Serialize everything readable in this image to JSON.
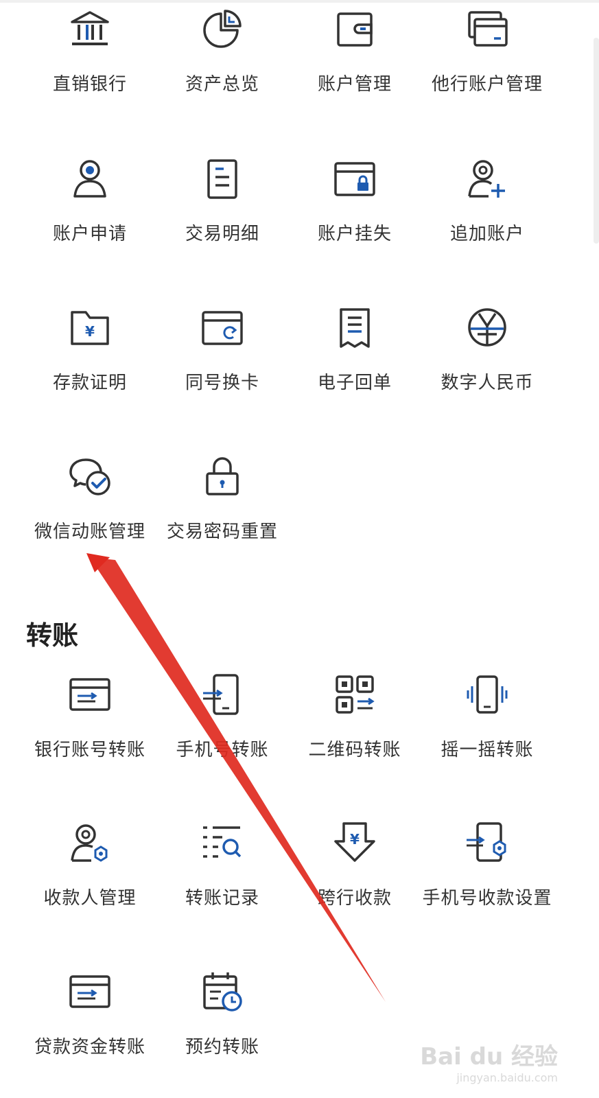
{
  "account_section": {
    "items": [
      {
        "label": "直销银行",
        "icon": "bank-icon"
      },
      {
        "label": "资产总览",
        "icon": "pie-chart-icon"
      },
      {
        "label": "账户管理",
        "icon": "wallet-icon"
      },
      {
        "label": "他行账户管理",
        "icon": "cards-icon"
      },
      {
        "label": "账户申请",
        "icon": "user-icon"
      },
      {
        "label": "交易明细",
        "icon": "document-icon"
      },
      {
        "label": "账户挂失",
        "icon": "card-lock-icon"
      },
      {
        "label": "追加账户",
        "icon": "user-add-icon"
      },
      {
        "label": "存款证明",
        "icon": "folder-yen-icon"
      },
      {
        "label": "同号换卡",
        "icon": "card-refresh-icon"
      },
      {
        "label": "电子回单",
        "icon": "receipt-icon"
      },
      {
        "label": "数字人民币",
        "icon": "digital-yuan-icon"
      },
      {
        "label": "微信动账管理",
        "icon": "wechat-check-icon"
      },
      {
        "label": "交易密码重置",
        "icon": "lock-icon"
      }
    ]
  },
  "transfer_section": {
    "title": "转账",
    "items": [
      {
        "label": "银行账号转账",
        "icon": "card-transfer-icon"
      },
      {
        "label": "手机号转账",
        "icon": "phone-transfer-icon"
      },
      {
        "label": "二维码转账",
        "icon": "qr-transfer-icon"
      },
      {
        "label": "摇一摇转账",
        "icon": "phone-shake-icon"
      },
      {
        "label": "收款人管理",
        "icon": "payee-manage-icon"
      },
      {
        "label": "转账记录",
        "icon": "list-search-icon"
      },
      {
        "label": "跨行收款",
        "icon": "yen-down-icon"
      },
      {
        "label": "手机号收款设置",
        "icon": "phone-settings-icon"
      },
      {
        "label": "贷款资金转账",
        "icon": "loan-transfer-icon"
      },
      {
        "label": "预约转账",
        "icon": "calendar-clock-icon"
      }
    ]
  },
  "colors": {
    "icon_dark": "#333333",
    "icon_accent": "#1e5bb0",
    "arrow": "#e02a20",
    "text": "#333333"
  },
  "watermark": {
    "main": "Bai du 经验",
    "sub": "jingyan.baidu.com"
  }
}
